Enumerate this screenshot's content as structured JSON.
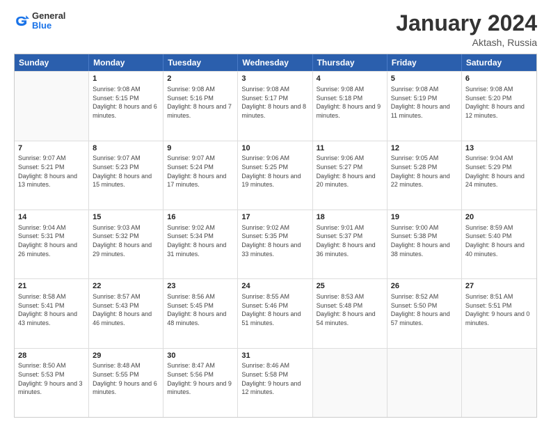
{
  "logo": {
    "general": "General",
    "blue": "Blue"
  },
  "title": "January 2024",
  "subtitle": "Aktash, Russia",
  "headers": [
    "Sunday",
    "Monday",
    "Tuesday",
    "Wednesday",
    "Thursday",
    "Friday",
    "Saturday"
  ],
  "weeks": [
    [
      {
        "day": "",
        "sunrise": "",
        "sunset": "",
        "daylight": ""
      },
      {
        "day": "1",
        "sunrise": "Sunrise: 9:08 AM",
        "sunset": "Sunset: 5:15 PM",
        "daylight": "Daylight: 8 hours and 6 minutes."
      },
      {
        "day": "2",
        "sunrise": "Sunrise: 9:08 AM",
        "sunset": "Sunset: 5:16 PM",
        "daylight": "Daylight: 8 hours and 7 minutes."
      },
      {
        "day": "3",
        "sunrise": "Sunrise: 9:08 AM",
        "sunset": "Sunset: 5:17 PM",
        "daylight": "Daylight: 8 hours and 8 minutes."
      },
      {
        "day": "4",
        "sunrise": "Sunrise: 9:08 AM",
        "sunset": "Sunset: 5:18 PM",
        "daylight": "Daylight: 8 hours and 9 minutes."
      },
      {
        "day": "5",
        "sunrise": "Sunrise: 9:08 AM",
        "sunset": "Sunset: 5:19 PM",
        "daylight": "Daylight: 8 hours and 11 minutes."
      },
      {
        "day": "6",
        "sunrise": "Sunrise: 9:08 AM",
        "sunset": "Sunset: 5:20 PM",
        "daylight": "Daylight: 8 hours and 12 minutes."
      }
    ],
    [
      {
        "day": "7",
        "sunrise": "Sunrise: 9:07 AM",
        "sunset": "Sunset: 5:21 PM",
        "daylight": "Daylight: 8 hours and 13 minutes."
      },
      {
        "day": "8",
        "sunrise": "Sunrise: 9:07 AM",
        "sunset": "Sunset: 5:23 PM",
        "daylight": "Daylight: 8 hours and 15 minutes."
      },
      {
        "day": "9",
        "sunrise": "Sunrise: 9:07 AM",
        "sunset": "Sunset: 5:24 PM",
        "daylight": "Daylight: 8 hours and 17 minutes."
      },
      {
        "day": "10",
        "sunrise": "Sunrise: 9:06 AM",
        "sunset": "Sunset: 5:25 PM",
        "daylight": "Daylight: 8 hours and 19 minutes."
      },
      {
        "day": "11",
        "sunrise": "Sunrise: 9:06 AM",
        "sunset": "Sunset: 5:27 PM",
        "daylight": "Daylight: 8 hours and 20 minutes."
      },
      {
        "day": "12",
        "sunrise": "Sunrise: 9:05 AM",
        "sunset": "Sunset: 5:28 PM",
        "daylight": "Daylight: 8 hours and 22 minutes."
      },
      {
        "day": "13",
        "sunrise": "Sunrise: 9:04 AM",
        "sunset": "Sunset: 5:29 PM",
        "daylight": "Daylight: 8 hours and 24 minutes."
      }
    ],
    [
      {
        "day": "14",
        "sunrise": "Sunrise: 9:04 AM",
        "sunset": "Sunset: 5:31 PM",
        "daylight": "Daylight: 8 hours and 26 minutes."
      },
      {
        "day": "15",
        "sunrise": "Sunrise: 9:03 AM",
        "sunset": "Sunset: 5:32 PM",
        "daylight": "Daylight: 8 hours and 29 minutes."
      },
      {
        "day": "16",
        "sunrise": "Sunrise: 9:02 AM",
        "sunset": "Sunset: 5:34 PM",
        "daylight": "Daylight: 8 hours and 31 minutes."
      },
      {
        "day": "17",
        "sunrise": "Sunrise: 9:02 AM",
        "sunset": "Sunset: 5:35 PM",
        "daylight": "Daylight: 8 hours and 33 minutes."
      },
      {
        "day": "18",
        "sunrise": "Sunrise: 9:01 AM",
        "sunset": "Sunset: 5:37 PM",
        "daylight": "Daylight: 8 hours and 36 minutes."
      },
      {
        "day": "19",
        "sunrise": "Sunrise: 9:00 AM",
        "sunset": "Sunset: 5:38 PM",
        "daylight": "Daylight: 8 hours and 38 minutes."
      },
      {
        "day": "20",
        "sunrise": "Sunrise: 8:59 AM",
        "sunset": "Sunset: 5:40 PM",
        "daylight": "Daylight: 8 hours and 40 minutes."
      }
    ],
    [
      {
        "day": "21",
        "sunrise": "Sunrise: 8:58 AM",
        "sunset": "Sunset: 5:41 PM",
        "daylight": "Daylight: 8 hours and 43 minutes."
      },
      {
        "day": "22",
        "sunrise": "Sunrise: 8:57 AM",
        "sunset": "Sunset: 5:43 PM",
        "daylight": "Daylight: 8 hours and 46 minutes."
      },
      {
        "day": "23",
        "sunrise": "Sunrise: 8:56 AM",
        "sunset": "Sunset: 5:45 PM",
        "daylight": "Daylight: 8 hours and 48 minutes."
      },
      {
        "day": "24",
        "sunrise": "Sunrise: 8:55 AM",
        "sunset": "Sunset: 5:46 PM",
        "daylight": "Daylight: 8 hours and 51 minutes."
      },
      {
        "day": "25",
        "sunrise": "Sunrise: 8:53 AM",
        "sunset": "Sunset: 5:48 PM",
        "daylight": "Daylight: 8 hours and 54 minutes."
      },
      {
        "day": "26",
        "sunrise": "Sunrise: 8:52 AM",
        "sunset": "Sunset: 5:50 PM",
        "daylight": "Daylight: 8 hours and 57 minutes."
      },
      {
        "day": "27",
        "sunrise": "Sunrise: 8:51 AM",
        "sunset": "Sunset: 5:51 PM",
        "daylight": "Daylight: 9 hours and 0 minutes."
      }
    ],
    [
      {
        "day": "28",
        "sunrise": "Sunrise: 8:50 AM",
        "sunset": "Sunset: 5:53 PM",
        "daylight": "Daylight: 9 hours and 3 minutes."
      },
      {
        "day": "29",
        "sunrise": "Sunrise: 8:48 AM",
        "sunset": "Sunset: 5:55 PM",
        "daylight": "Daylight: 9 hours and 6 minutes."
      },
      {
        "day": "30",
        "sunrise": "Sunrise: 8:47 AM",
        "sunset": "Sunset: 5:56 PM",
        "daylight": "Daylight: 9 hours and 9 minutes."
      },
      {
        "day": "31",
        "sunrise": "Sunrise: 8:46 AM",
        "sunset": "Sunset: 5:58 PM",
        "daylight": "Daylight: 9 hours and 12 minutes."
      },
      {
        "day": "",
        "sunrise": "",
        "sunset": "",
        "daylight": ""
      },
      {
        "day": "",
        "sunrise": "",
        "sunset": "",
        "daylight": ""
      },
      {
        "day": "",
        "sunrise": "",
        "sunset": "",
        "daylight": ""
      }
    ]
  ]
}
